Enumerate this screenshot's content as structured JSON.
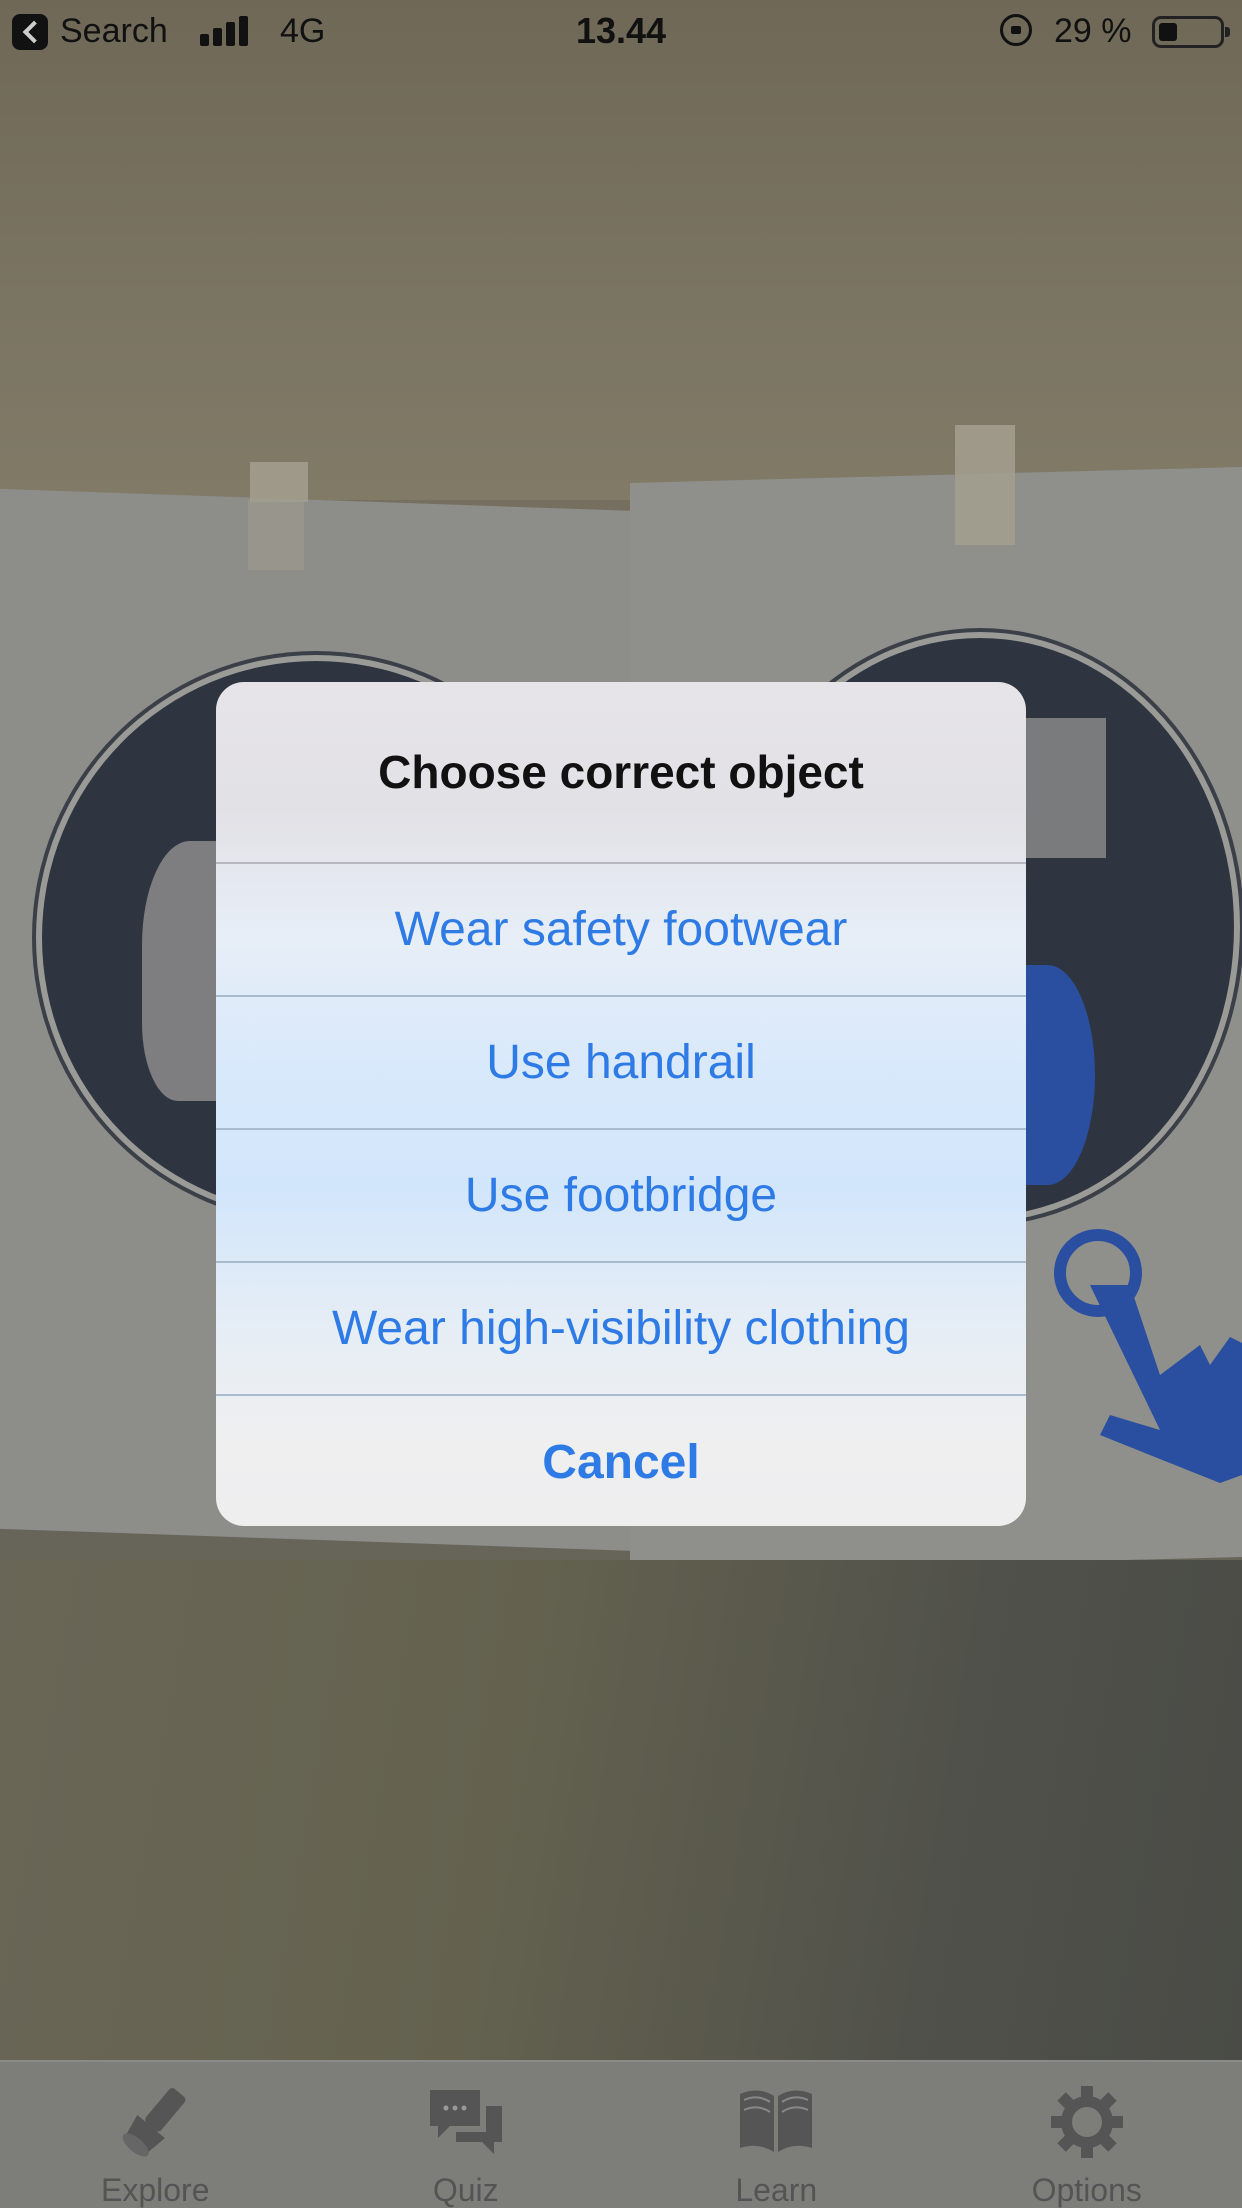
{
  "status_bar": {
    "back_label": "Search",
    "network": "4G",
    "time": "13.44",
    "battery_percent": "29 %"
  },
  "alert": {
    "title": "Choose correct object",
    "actions": [
      "Wear safety footwear",
      "Use handrail",
      "Use footbridge",
      "Wear high-visibility clothing"
    ],
    "cancel_label": "Cancel"
  },
  "tab_bar": {
    "tabs": [
      {
        "label": "Explore",
        "icon": "flashlight-icon"
      },
      {
        "label": "Quiz",
        "icon": "chat-bubbles-icon"
      },
      {
        "label": "Learn",
        "icon": "book-icon"
      },
      {
        "label": "Options",
        "icon": "gear-icon"
      }
    ]
  },
  "colors": {
    "accent": "#2f7be6",
    "overlay_blue": "#2a4fa0"
  }
}
